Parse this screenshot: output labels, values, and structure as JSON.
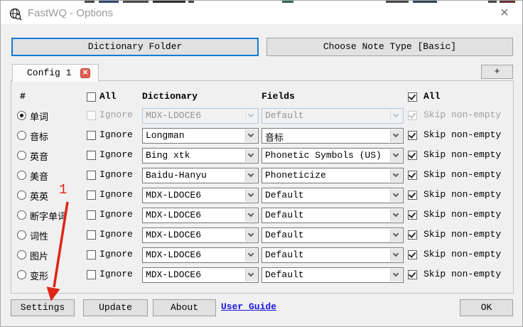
{
  "window": {
    "title": "FastWQ - Options",
    "close_icon": "✕",
    "tab_close_icon": "✕"
  },
  "top_buttons": {
    "dictionary_folder": "Dictionary Folder",
    "choose_note_type": "Choose Note Type [Basic]"
  },
  "tabs": {
    "config_tab": "Config 1",
    "add_button": "+"
  },
  "table": {
    "headers": {
      "number": "#",
      "all_left": "All",
      "dictionary": "Dictionary",
      "fields": "Fields",
      "all_right": "All"
    },
    "labels": {
      "ignore": "Ignore",
      "skip": "Skip non-empty"
    },
    "rows": [
      {
        "label": "单词",
        "dictionary": "MDX-LDOCE6",
        "field": "Default"
      },
      {
        "label": "音标",
        "dictionary": "Longman",
        "field": "音标"
      },
      {
        "label": "英音",
        "dictionary": "Bing xtk",
        "field": "Phonetic Symbols (US)"
      },
      {
        "label": "美音",
        "dictionary": "Baidu-Hanyu",
        "field": "Phoneticize"
      },
      {
        "label": "英英",
        "dictionary": "MDX-LDOCE6",
        "field": "Default"
      },
      {
        "label": "断字单词",
        "dictionary": "MDX-LDOCE6",
        "field": "Default"
      },
      {
        "label": "词性",
        "dictionary": "MDX-LDOCE6",
        "field": "Default"
      },
      {
        "label": "图片",
        "dictionary": "MDX-LDOCE6",
        "field": "Default"
      },
      {
        "label": "变形",
        "dictionary": "MDX-LDOCE6",
        "field": "Default"
      }
    ]
  },
  "annotation": {
    "step_number": "1",
    "color": "#e02416"
  },
  "footer": {
    "settings": "Settings",
    "update": "Update",
    "about": "About",
    "user_guide": "User Guide",
    "ok": "OK"
  },
  "colors": {
    "focus_border": "#0f7cd6",
    "link": "#1b16e3",
    "tab_close_bg": "#e0604e",
    "annotation_red": "#e02416",
    "dialog_bg": "#f0f0f0"
  }
}
